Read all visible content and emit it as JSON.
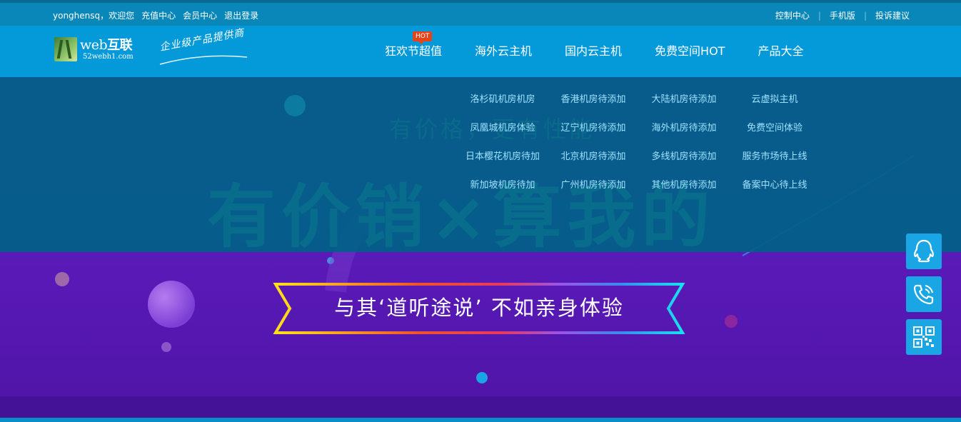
{
  "topbar": {
    "username": "yonghensq，欢迎您",
    "recharge": "充值中心",
    "member": "会员中心",
    "logout": "退出登录",
    "control": "控制中心",
    "mobile": "手机版",
    "complaint": "投诉建议"
  },
  "logo": {
    "brand_prefix": "web",
    "brand_cn": "互联",
    "domain": "52webh1.com",
    "slogan": "企业级产品提供商"
  },
  "nav": [
    {
      "label": "狂欢节超值",
      "badge": "HOT"
    },
    {
      "label": "海外云主机"
    },
    {
      "label": "国内云主机"
    },
    {
      "label": "免费空间HOT"
    },
    {
      "label": "产品大全"
    }
  ],
  "dropdown": {
    "items": [
      "洛杉矶机房机房",
      "香港机房待添加",
      "大陆机房待添加",
      "云虚拟主机",
      "凤凰城机房体验",
      "辽宁机房待添加",
      "海外机房待添加",
      "免费空间体验",
      "日本樱花机房待加",
      "北京机房待添加",
      "多线机房待添加",
      "服务市场待上线",
      "新加坡机房待加",
      "广州机房待添加",
      "其他机房待添加",
      "备案中心待上线"
    ]
  },
  "banner": {
    "headline": "与其‘道听途说’ 不如亲身体验",
    "bg_big": "有价销×算我的",
    "bg_small": "有价格，更有性能"
  },
  "float_buttons": [
    {
      "icon": "qq-icon"
    },
    {
      "icon": "phone-icon"
    },
    {
      "icon": "qrcode-icon"
    }
  ],
  "colors": {
    "header": "#049ad9",
    "topbar": "#0887b8",
    "banner_purple": "#6a22c9",
    "hot_badge": "#e4441a",
    "float_button": "#1aa6e4"
  }
}
